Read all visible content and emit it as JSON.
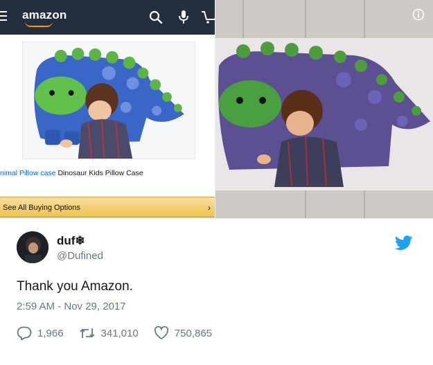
{
  "amazon": {
    "logo": "amazon",
    "product_title_link": "nimal Pillow case",
    "product_title_rest": " Dinosaur Kids Pillow Case",
    "buy_options_label": "See All Buying Options",
    "buy_options_chevron": "›",
    "icons": [
      "menu-icon",
      "search-icon",
      "microphone-icon",
      "cart-icon"
    ],
    "brand_colors": {
      "bar": "#232f3e",
      "accent": "#ff9900",
      "button": "#f0c14b"
    }
  },
  "tweet": {
    "display_name": "duf❄",
    "handle": "@Dufined",
    "text": "Thank you Amazon.",
    "timestamp": "2:59 AM - Nov 29, 2017",
    "replies": "1,966",
    "retweets": "341,010",
    "likes": "750,865",
    "icons": [
      "twitter-bird-icon",
      "reply-icon",
      "retweet-icon",
      "heart-icon"
    ],
    "brand_color": "#1da1f2"
  }
}
